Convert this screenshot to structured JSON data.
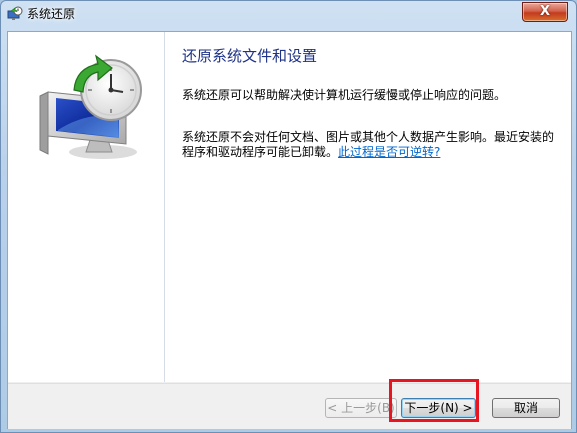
{
  "window": {
    "title": "系统还原",
    "close_label": "X",
    "title_icon": "system-restore-icon"
  },
  "sidebar": {
    "illustration": "system-restore-clock-monitor-icon"
  },
  "content": {
    "heading": "还原系统文件和设置",
    "paragraph1": "系统还原可以帮助解决使计算机运行缓慢或停止响应的问题。",
    "paragraph2": "系统还原不会对任何文档、图片或其他个人数据产生影响。最近安装的程序和驱动程序可能已卸载。",
    "link": "此过程是否可逆转?"
  },
  "buttons": {
    "back": "< 上一步(B)",
    "next": "下一步(N) >",
    "cancel": "取消"
  },
  "colors": {
    "heading": "#1e3287",
    "link": "#0066cc",
    "highlight": "#e8141f"
  }
}
